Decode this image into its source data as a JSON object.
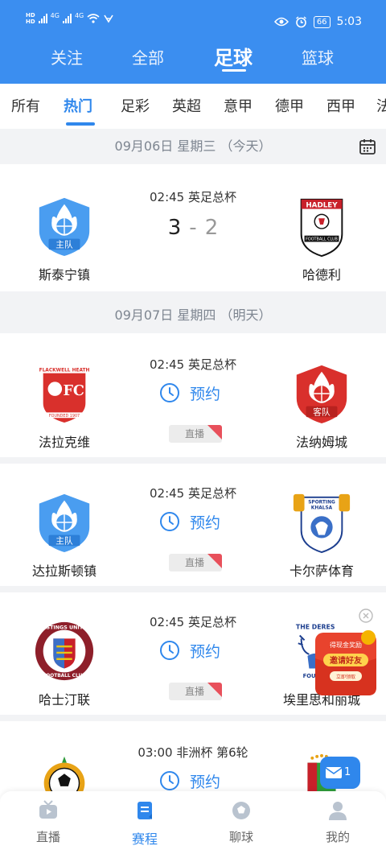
{
  "status_bar": {
    "network_left": [
      "4G",
      "4G"
    ],
    "battery": "66",
    "time": "5:03"
  },
  "top_tabs": [
    {
      "label": "关注"
    },
    {
      "label": "全部"
    },
    {
      "label": "足球",
      "active": true
    },
    {
      "label": "篮球"
    }
  ],
  "sub_tabs": [
    {
      "label": "所有"
    },
    {
      "label": "热门",
      "active": true
    },
    {
      "label": "足彩"
    },
    {
      "label": "英超"
    },
    {
      "label": "意甲"
    },
    {
      "label": "德甲"
    },
    {
      "label": "西甲"
    },
    {
      "label": "法"
    }
  ],
  "date_groups": [
    {
      "date": "09月06日 星期三 （今天）",
      "matches": [
        {
          "time_competition": "02:45 英足总杯",
          "home": {
            "name": "斯泰宁镇",
            "badge": "home-team-badge"
          },
          "away": {
            "name": "哈德利",
            "badge": "hadley-fc-badge"
          },
          "score_home": "3",
          "score_separator": "-",
          "score_away": "2"
        }
      ]
    },
    {
      "date": "09月07日 星期四 （明天）",
      "matches": [
        {
          "time_competition": "02:45 英足总杯",
          "home": {
            "name": "法拉克维",
            "badge": "flackwell-heath-badge"
          },
          "away": {
            "name": "法纳姆城",
            "badge": "away-team-badge"
          },
          "reserve_label": "预约",
          "live_label": "直播"
        },
        {
          "time_competition": "02:45 英足总杯",
          "home": {
            "name": "达拉斯顿镇",
            "badge": "home-team-badge"
          },
          "away": {
            "name": "卡尔萨体育",
            "badge": "sporting-khalsa-badge"
          },
          "reserve_label": "预约",
          "live_label": "直播"
        },
        {
          "time_competition": "02:45 英足总杯",
          "home": {
            "name": "哈士汀联",
            "badge": "hastings-united-badge"
          },
          "away": {
            "name": "埃里思和丽城",
            "badge": "the-deres-badge"
          },
          "reserve_label": "预约",
          "live_label": "直播"
        },
        {
          "time_competition": "03:00 非洲杯 第6轮",
          "home": {
            "name": "",
            "badge": "football-badge"
          },
          "away": {
            "name": "",
            "badge": "national-team-badge"
          },
          "reserve_label": "预约"
        }
      ]
    }
  ],
  "promo": {
    "line1": "得现金奖励",
    "line2": "邀请好友",
    "line3": "立即领取"
  },
  "message_badge": {
    "count": "1"
  },
  "bottom_nav": [
    {
      "label": "直播",
      "icon": "tv-icon"
    },
    {
      "label": "赛程",
      "icon": "schedule-icon",
      "active": true
    },
    {
      "label": "聊球",
      "icon": "chat-ball-icon"
    },
    {
      "label": "我的",
      "icon": "profile-icon"
    }
  ],
  "colors": {
    "header_blue": "#3b8ef0",
    "accent_blue": "#2f87ec",
    "badge_blue": "#4a9df0",
    "badge_red": "#d9302c"
  }
}
